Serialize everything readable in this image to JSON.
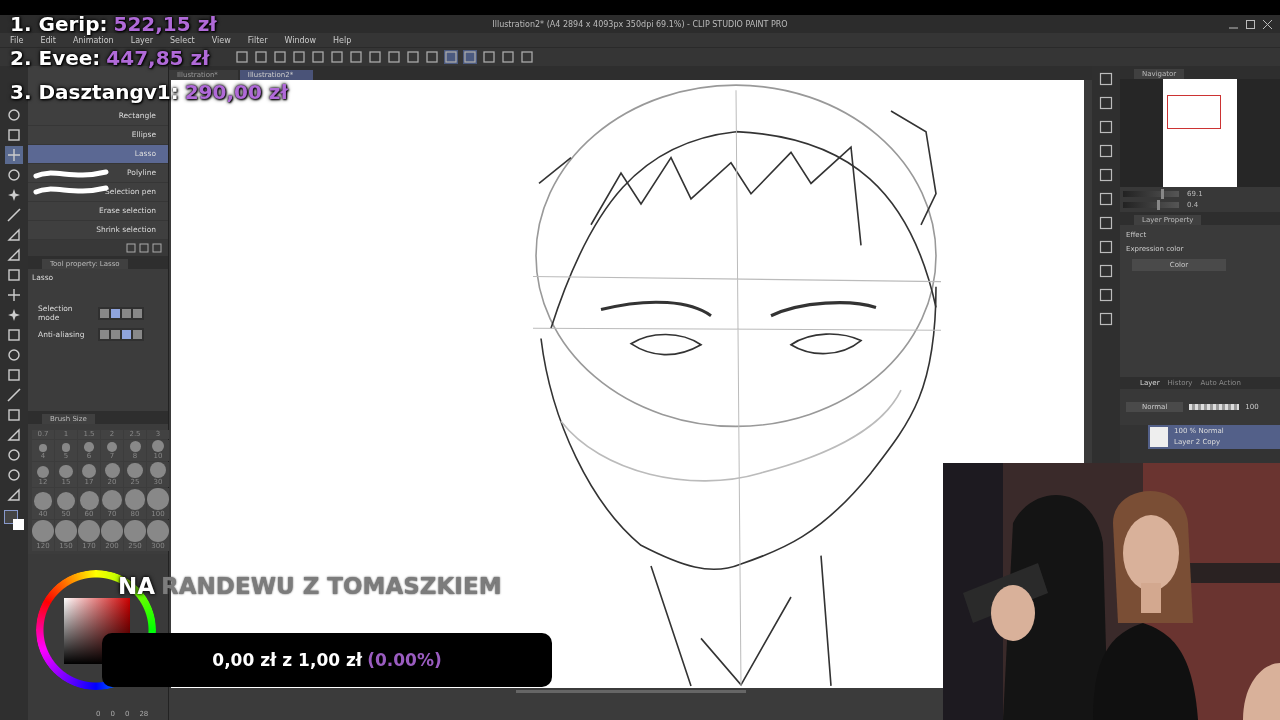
{
  "leaderboard": [
    {
      "name": "1. Gerip:",
      "amount": "522,15 zł"
    },
    {
      "name": "2. Evee:",
      "amount": "447,85 zł"
    },
    {
      "name": "3. Dasztangv1:",
      "amount": "290,00 zł"
    }
  ],
  "window": {
    "title": "Illustration2* (A4 2894 x 4093px 350dpi 69.1%)  - CLIP STUDIO PAINT PRO"
  },
  "menu": [
    "File",
    "Edit",
    "Animation",
    "Layer",
    "Select",
    "View",
    "Filter",
    "Window",
    "Help"
  ],
  "document_tabs": [
    {
      "label": "Illustration*",
      "selected": false
    },
    {
      "label": "Illustration2*",
      "selected": true
    }
  ],
  "sub_tools": [
    {
      "label": "Rectangle",
      "selected": false
    },
    {
      "label": "Ellipse",
      "selected": false
    },
    {
      "label": "Lasso",
      "selected": true
    },
    {
      "label": "Polyline",
      "selected": false
    },
    {
      "label": "Selection pen",
      "selected": false
    },
    {
      "label": "Erase selection",
      "selected": false
    },
    {
      "label": "Shrink selection",
      "selected": false
    }
  ],
  "tool_property": {
    "tab": "Tool property: Lasso",
    "name": "Lasso",
    "rows": [
      {
        "label": "Selection mode",
        "options": [
          {
            "selected": false
          },
          {
            "selected": true
          },
          {
            "selected": false
          },
          {
            "selected": false
          }
        ]
      },
      {
        "label": "Anti-aliasing",
        "options": [
          {
            "selected": false
          },
          {
            "selected": false
          },
          {
            "selected": true
          },
          {
            "selected": false
          }
        ]
      }
    ]
  },
  "brush_size": {
    "tab": "Brush Size",
    "sizes": [
      "0.7",
      "1",
      "1.5",
      "2",
      "2.5",
      "3",
      "4",
      "5",
      "6",
      "7",
      "8",
      "10",
      "12",
      "15",
      "17",
      "20",
      "25",
      "30",
      "40",
      "50",
      "60",
      "70",
      "80",
      "100",
      "120",
      "150",
      "170",
      "200",
      "250",
      "300"
    ]
  },
  "color_panel": {
    "readings": [
      "0",
      "0",
      "0",
      "28"
    ]
  },
  "navigator": {
    "tab": "Navigator",
    "zoom": "69.1",
    "zoom_slider": {
      "level": 0.68
    },
    "rotation": "0.4",
    "rotation_slider": {
      "level": 0.6
    }
  },
  "layer_property": {
    "tab": "Layer Property",
    "effect_label": "Effect",
    "expression_label": "Expression color",
    "expression_value": "Color"
  },
  "layer_panel": {
    "tabs": [
      {
        "label": "Layer",
        "selected": true
      },
      {
        "label": "History",
        "selected": false
      },
      {
        "label": "Auto Action",
        "selected": false
      }
    ],
    "blend_mode": "Normal",
    "opacity": "100",
    "opacity_slider": {
      "level": 1
    },
    "layers": [
      {
        "mode": "100 % Normal",
        "name": "Layer 2 Copy",
        "selected": true
      }
    ]
  },
  "stream_title": {
    "lead": "NA",
    "rest": "RANDEWU Z TOMASZKIEM"
  },
  "goal": {
    "amount": "0,00 zł z 1,00 zł",
    "percent": "(0.00%)",
    "level": 0
  }
}
